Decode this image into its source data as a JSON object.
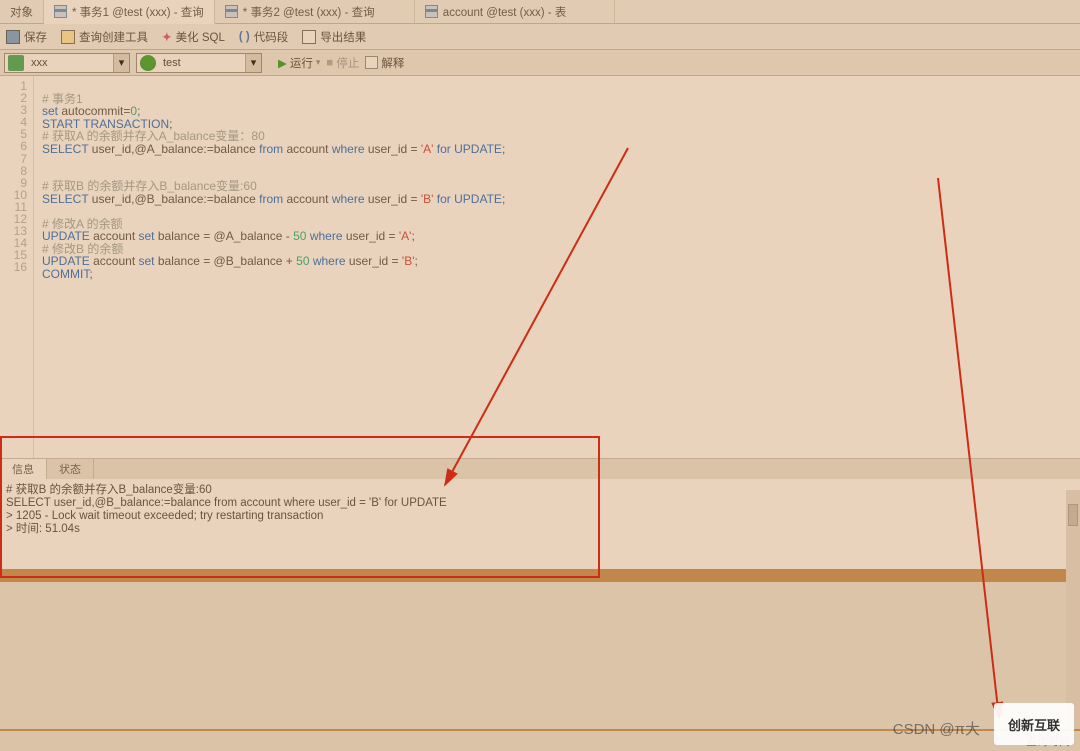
{
  "tabs": [
    {
      "label": "对象"
    },
    {
      "label": "* 事务1 @test (xxx) - 查询",
      "active": true
    },
    {
      "label": "* 事务2 @test (xxx) - 查询"
    },
    {
      "label": "account @test (xxx) - 表"
    }
  ],
  "toolbar": {
    "save": "保存",
    "querybuild": "查询创建工具",
    "beautify": "美化 SQL",
    "codesnip": "代码段",
    "export": "导出结果",
    "brace": "( )"
  },
  "combos": {
    "conn": "xxx",
    "db": "test"
  },
  "actions": {
    "run": "运行",
    "stop": "停止",
    "explain": "解释"
  },
  "lines": [
    "1",
    "2",
    "3",
    "4",
    "5",
    "6",
    "7",
    "8",
    "9",
    "10",
    "11",
    "12",
    "13",
    "14",
    "15",
    "16"
  ],
  "code": {
    "l1": "# 事务1",
    "l2a": "set",
    "l2b": " autocommit=",
    "l2c": "0",
    "l2d": ";",
    "l3a": "START TRANSACTION",
    "l3b": ";",
    "l4": "# 获取A 的余额并存入A_balance变量：80",
    "l5a": "SELECT",
    "l5b": " user_id,@A_balance:=balance ",
    "l5c": "from",
    "l5d": " account ",
    "l5e": "where",
    "l5f": " user_id = ",
    "l5g": "'A'",
    "l5h": " for ",
    "l5i": "UPDATE",
    "l5j": ";",
    "l8": "# 获取B 的余额并存入B_balance变量:60",
    "l9a": "SELECT",
    "l9b": " user_id,@B_balance:=balance ",
    "l9c": "from",
    "l9d": " account ",
    "l9e": "where",
    "l9f": " user_id = ",
    "l9g": "'B'",
    "l9h": " for ",
    "l9i": "UPDATE",
    "l9j": ";",
    "l11": "# 修改A 的余额",
    "l12a": "UPDATE",
    "l12b": " account ",
    "l12c": "set",
    "l12d": " balance = @A_balance - ",
    "l12e": "50",
    "l12f": " where ",
    "l12g": "user_id = ",
    "l12h": "'A'",
    "l12i": ";",
    "l13": "# 修改B 的余额",
    "l14a": "UPDATE",
    "l14b": " account ",
    "l14c": "set",
    "l14d": " balance = @B_balance + ",
    "l14e": "50",
    "l14f": " where ",
    "l14g": "user_id = ",
    "l14h": "'B'",
    "l14i": ";",
    "l15a": "COMMIT",
    "l15b": ";"
  },
  "result": {
    "tab_info": "信息",
    "tab_status": "状态",
    "line1": "# 获取B 的余额并存入B_balance变量:60",
    "line2": "SELECT user_id,@B_balance:=balance from account where user_id = 'B' for UPDATE",
    "line3": "> 1205 - Lock wait timeout exceeded; try restarting transaction",
    "line4": "> 时间: 51.04s"
  },
  "footer": {
    "label": "查询时间"
  },
  "watermark": "CSDN @π大",
  "logo": "创新互联"
}
